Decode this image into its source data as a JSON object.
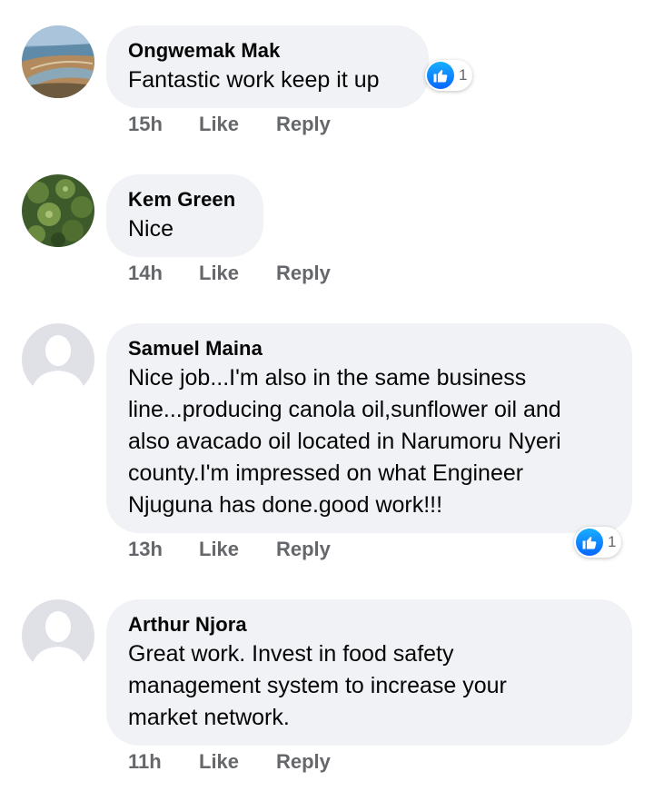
{
  "comments": [
    {
      "author": "Ongwemak Mak",
      "text": "Fantastic work keep it up",
      "time": "15h",
      "like_label": "Like",
      "reply_label": "Reply",
      "reactions": "1",
      "avatar": "landscape-photo"
    },
    {
      "author": "Kem Green",
      "text": "Nice",
      "time": "14h",
      "like_label": "Like",
      "reply_label": "Reply",
      "avatar": "avocado-photo"
    },
    {
      "author": "Samuel Maina",
      "text_lines": [
        "Nice job...I'm also in the same business",
        "line...producing canola oil,sunflower oil and",
        "also avacado oil located in Narumoru Nyeri",
        "county.I'm impressed on what Engineer",
        "Njuguna has done.good work!!!"
      ],
      "time": "13h",
      "like_label": "Like",
      "reply_label": "Reply",
      "reactions": "1",
      "avatar": "default-profile-silhouette"
    },
    {
      "author": "Arthur Njora",
      "text_lines": [
        "Great work. Invest in food safety",
        "management system to increase your",
        "market network."
      ],
      "time": "11h",
      "like_label": "Like",
      "reply_label": "Reply",
      "avatar": "default-profile-silhouette"
    }
  ],
  "colors": {
    "bubble": "#f0f2f5",
    "meta_text": "#65676b",
    "like_blue": "#0866ff"
  }
}
